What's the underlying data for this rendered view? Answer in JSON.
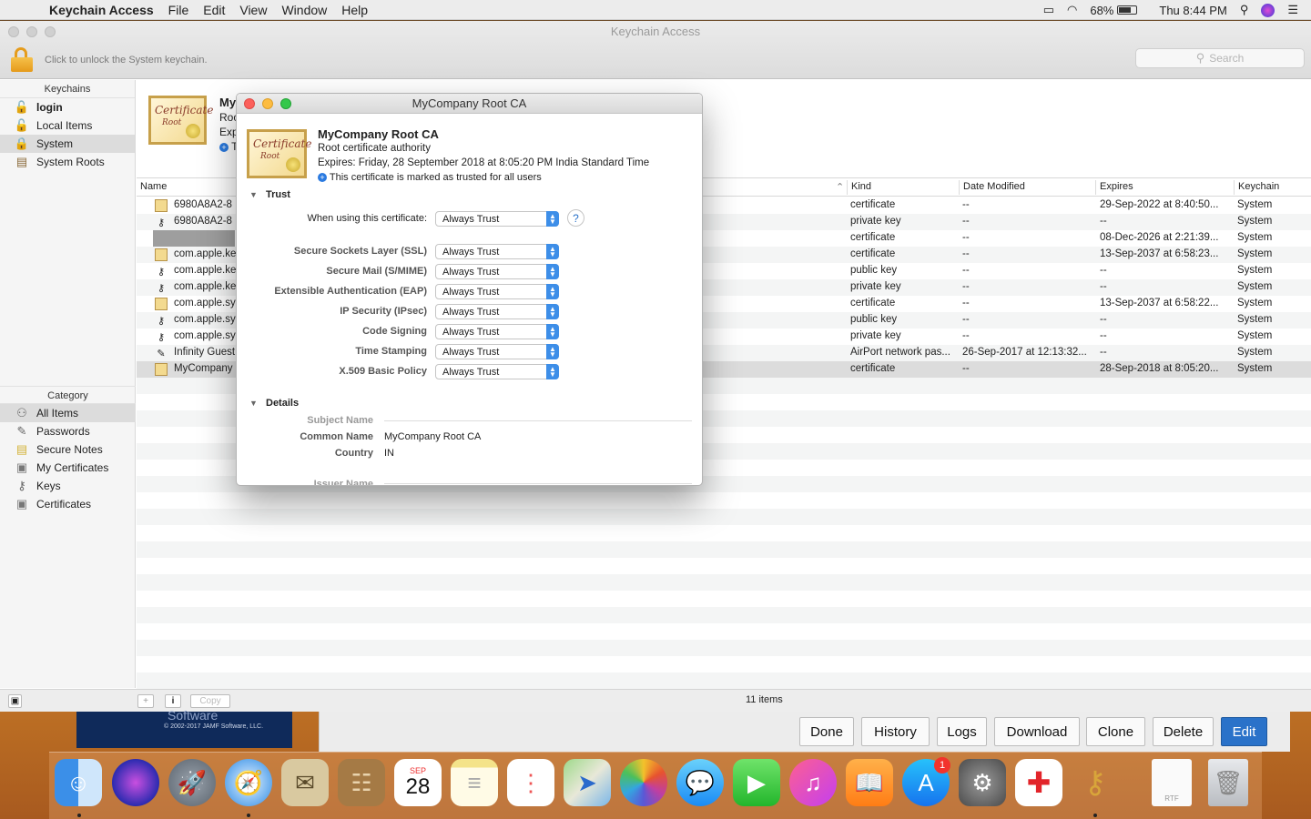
{
  "menubar": {
    "app_name": "Keychain Access",
    "menus": [
      "File",
      "Edit",
      "View",
      "Window",
      "Help"
    ],
    "battery": "68%",
    "clock": "Thu 8:44 PM"
  },
  "window": {
    "title": "Keychain Access",
    "lock_text": "Click to unlock the System keychain.",
    "search_placeholder": "Search"
  },
  "sidebar": {
    "keychains_header": "Keychains",
    "keychains": [
      {
        "label": "login",
        "icon": "lock-open-icon"
      },
      {
        "label": "Local Items",
        "icon": "lock-open-icon"
      },
      {
        "label": "System",
        "icon": "lock-icon"
      },
      {
        "label": "System Roots",
        "icon": "cabinet-icon"
      }
    ],
    "category_header": "Category",
    "categories": [
      {
        "label": "All Items",
        "icon": "people-icon"
      },
      {
        "label": "Passwords",
        "icon": "pencil-icon"
      },
      {
        "label": "Secure Notes",
        "icon": "note-icon"
      },
      {
        "label": "My Certificates",
        "icon": "certificate-icon"
      },
      {
        "label": "Keys",
        "icon": "key-icon"
      },
      {
        "label": "Certificates",
        "icon": "certificate-icon"
      }
    ]
  },
  "info": {
    "name": "My",
    "line2": "Roo",
    "line3": "Exp",
    "line4": "T"
  },
  "table": {
    "columns": [
      "Name",
      "Kind",
      "Date Modified",
      "Expires",
      "Keychain"
    ],
    "rows": [
      {
        "name": "6980A8A2-8",
        "kind": "certificate",
        "modified": "--",
        "expires": "29-Sep-2022 at 8:40:50...",
        "keychain": "System",
        "icon": "cert"
      },
      {
        "name": "6980A8A2-8",
        "kind": "private key",
        "modified": "--",
        "expires": "--",
        "keychain": "System",
        "icon": "key"
      },
      {
        "name": "",
        "kind": "certificate",
        "modified": "--",
        "expires": "08-Dec-2026 at 2:21:39...",
        "keychain": "System",
        "icon": "none"
      },
      {
        "name": "com.apple.ke",
        "kind": "certificate",
        "modified": "--",
        "expires": "13-Sep-2037 at 6:58:23...",
        "keychain": "System",
        "icon": "cert"
      },
      {
        "name": "com.apple.ke",
        "kind": "public key",
        "modified": "--",
        "expires": "--",
        "keychain": "System",
        "icon": "key"
      },
      {
        "name": "com.apple.ke",
        "kind": "private key",
        "modified": "--",
        "expires": "--",
        "keychain": "System",
        "icon": "key"
      },
      {
        "name": "com.apple.sy",
        "kind": "certificate",
        "modified": "--",
        "expires": "13-Sep-2037 at 6:58:22...",
        "keychain": "System",
        "icon": "cert"
      },
      {
        "name": "com.apple.sy",
        "kind": "public key",
        "modified": "--",
        "expires": "--",
        "keychain": "System",
        "icon": "key"
      },
      {
        "name": "com.apple.sy",
        "kind": "private key",
        "modified": "--",
        "expires": "--",
        "keychain": "System",
        "icon": "key"
      },
      {
        "name": "Infinity Guest",
        "kind": "AirPort network pas...",
        "modified": "26-Sep-2017 at 12:13:32...",
        "expires": "--",
        "keychain": "System",
        "icon": "pencil"
      },
      {
        "name": "MyCompany",
        "kind": "certificate",
        "modified": "--",
        "expires": "28-Sep-2018 at 8:05:20...",
        "keychain": "System",
        "icon": "cert"
      }
    ],
    "count": "11 items",
    "copy_label": "Copy"
  },
  "background_app": {
    "brand": "Software",
    "copyright": "© 2002-2017 JAMF Software, LLC.",
    "buttons": [
      "Done",
      "History",
      "Logs",
      "Download",
      "Clone",
      "Delete",
      "Edit"
    ]
  },
  "dialog": {
    "title": "MyCompany Root CA",
    "cert_name": "MyCompany Root CA",
    "cert_type": "Root certificate authority",
    "expires": "Expires: Friday, 28 September 2018 at 8:05:20 PM India Standard Time",
    "trusted_note": "This certificate is marked as trusted for all users",
    "trust_header": "Trust",
    "when_using_label": "When using this certificate:",
    "when_using_value": "Always Trust",
    "trust_settings": [
      {
        "label": "Secure Sockets Layer (SSL)",
        "value": "Always Trust"
      },
      {
        "label": "Secure Mail (S/MIME)",
        "value": "Always Trust"
      },
      {
        "label": "Extensible Authentication (EAP)",
        "value": "Always Trust"
      },
      {
        "label": "IP Security (IPsec)",
        "value": "Always Trust"
      },
      {
        "label": "Code Signing",
        "value": "Always Trust"
      },
      {
        "label": "Time Stamping",
        "value": "Always Trust"
      },
      {
        "label": "X.509 Basic Policy",
        "value": "Always Trust"
      }
    ],
    "details_header": "Details",
    "subject_name_label": "Subject Name",
    "common_name_label": "Common Name",
    "common_name_value": "MyCompany Root CA",
    "country_label": "Country",
    "country_value": "IN",
    "issuer_name_label": "Issuer Name"
  },
  "cert_icon_text": {
    "title": "Certificate",
    "sub": "Root"
  },
  "dock": {
    "calendar_month": "SEP",
    "calendar_day": "28",
    "appstore_badge": "1",
    "rtf_label": "RTF"
  },
  "colors": {
    "accent": "#2a72c9",
    "popup_blue": "#3d8ee8"
  }
}
